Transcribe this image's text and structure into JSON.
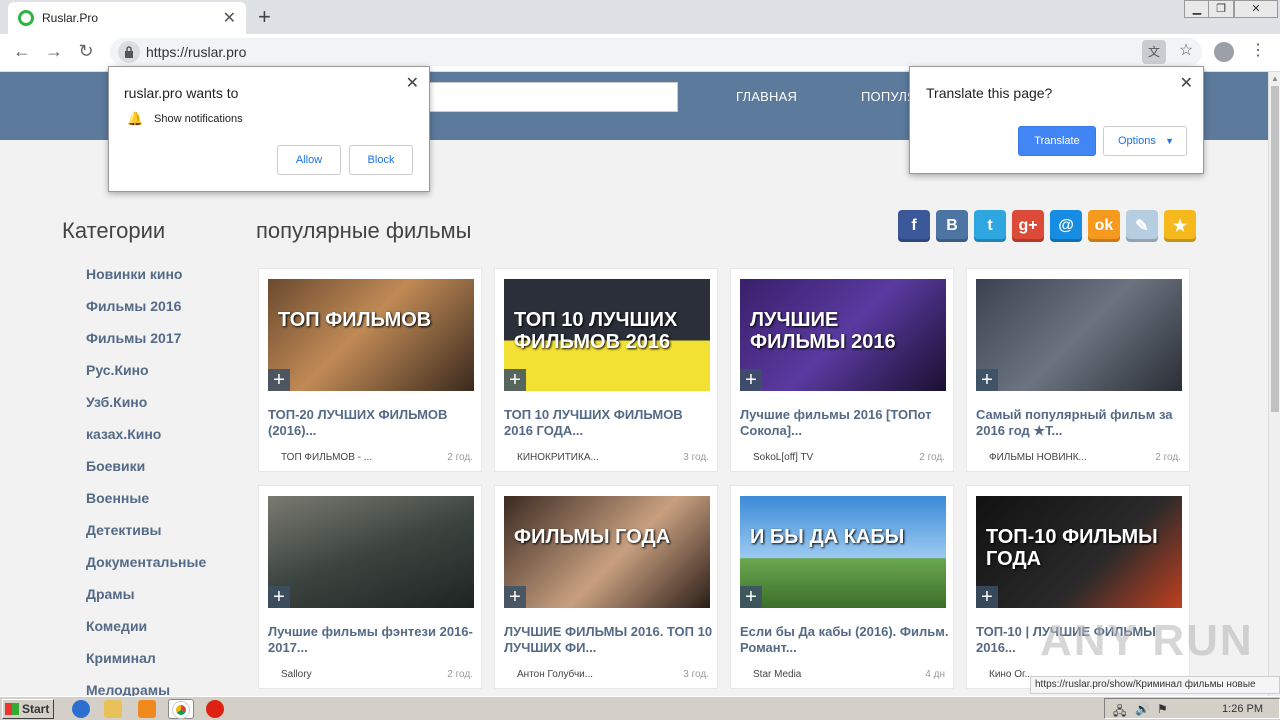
{
  "browser": {
    "tab_title": "Ruslar.Pro",
    "url": "https://ruslar.pro",
    "new_tab": "+",
    "tab_close": "✕"
  },
  "site": {
    "nav": [
      "ГЛАВНАЯ",
      "ПОПУЛЯ"
    ]
  },
  "sidebar": {
    "title": "Категории",
    "items": [
      "Новинки кино",
      "Фильмы 2016",
      "Фильмы 2017",
      "Рус.Кино",
      "Узб.Кино",
      "казах.Кино",
      "Боевики",
      "Военные",
      "Детективы",
      "Документальные",
      "Драмы",
      "Комедии",
      "Криминал",
      "Мелодрамы"
    ]
  },
  "main": {
    "title": "популярные фильмы",
    "share": [
      {
        "icon": "facebook-icon",
        "glyph": "f",
        "color": "#3b5998"
      },
      {
        "icon": "vk-icon",
        "glyph": "B",
        "color": "#4c75a3"
      },
      {
        "icon": "twitter-icon",
        "glyph": "t",
        "color": "#2ea7e0"
      },
      {
        "icon": "google-plus-icon",
        "glyph": "g+",
        "color": "#dc4a38"
      },
      {
        "icon": "mail-icon",
        "glyph": "@",
        "color": "#168de2"
      },
      {
        "icon": "odnoklassniki-icon",
        "glyph": "ok",
        "color": "#f59a1f"
      },
      {
        "icon": "livejournal-icon",
        "glyph": "✎",
        "color": "#b7cde0"
      },
      {
        "icon": "favorite-star-icon",
        "glyph": "★",
        "color": "#f5b91e"
      }
    ],
    "cards": [
      {
        "title": "ТОП-20 ЛУЧШИХ ФИЛЬМОВ (2016)...",
        "author": "ТОП ФИЛЬМОВ - ...",
        "age": "2 год.",
        "thumb_text": "ТОП ФИЛЬМОВ",
        "bg": "linear-gradient(135deg,#6b4a2e,#c08a55 45%,#3a2a1e)"
      },
      {
        "title": "ТОП 10 ЛУЧШИХ ФИЛЬМОВ 2016 ГОДА...",
        "author": "КИНОКРИТИКА...",
        "age": "3 год.",
        "thumb_text": "ТОП 10 ЛУЧШИХ ФИЛЬМОВ 2016",
        "bg": "linear-gradient(180deg,#2b2f3a 0%,#2b2f3a 55%,#f2e033 55%)"
      },
      {
        "title": "Лучшие фильмы 2016 [ТОПот Сокола]...",
        "author": "SokoL[off] TV",
        "age": "2 год.",
        "thumb_text": "ЛУЧШИЕ ФИЛЬМЫ 2016",
        "bg": "linear-gradient(135deg,#3a1f6b,#5a3aa0 50%,#1a1030)"
      },
      {
        "title": "Самый популярный фильм за 2016 год ★Т...",
        "author": "ФИЛЬМЫ НОВИНК...",
        "age": "2 год.",
        "thumb_text": "",
        "bg": "linear-gradient(135deg,#3a4250,#6b7480 50%,#2a2e36)"
      },
      {
        "title": "Лучшие фильмы фэнтези 2016-2017...",
        "author": "Sallory",
        "age": "2 год.",
        "thumb_text": "",
        "bg": "linear-gradient(160deg,#7a7a70,#3c4440 50%,#1e2422)"
      },
      {
        "title": "ЛУЧШИЕ ФИЛЬМЫ 2016. ТОП 10 ЛУЧШИХ ФИ...",
        "author": "Антон Голубчи...",
        "age": "3 год.",
        "thumb_text": "ФИЛЬМЫ ГОДА",
        "bg": "linear-gradient(135deg,#3a2a22,#c8a080 55%,#2a1e18)"
      },
      {
        "title": "Если бы Да кабы (2016). Фильм. Романт...",
        "author": "Star Media",
        "age": "4 дн",
        "thumb_text": "И БЫ ДА КАБЫ",
        "bg": "linear-gradient(180deg,#3b8ad8 0%,#9ccaf0 55%,#6aa84f 56%,#3c6e2a)"
      },
      {
        "title": "ТОП-10 | ЛУЧШИЕ ФИЛЬМЫ 2016...",
        "author": "Кино Ог...",
        "age": "",
        "thumb_text": "ТОП-10 ФИЛЬМЫ ГОДА",
        "bg": "linear-gradient(135deg,#111,#2a2a2a 60%,#c04020)"
      }
    ]
  },
  "notification_popup": {
    "title": "ruslar.pro wants to",
    "item": "Show notifications",
    "allow": "Allow",
    "block": "Block"
  },
  "translate_popup": {
    "title": "Translate this page?",
    "translate": "Translate",
    "options": "Options"
  },
  "status_url": "https://ruslar.pro/show/Криминал фильмы новые",
  "watermark": "ANY RUN",
  "taskbar": {
    "start": "Start",
    "clock": "1:26 PM"
  }
}
